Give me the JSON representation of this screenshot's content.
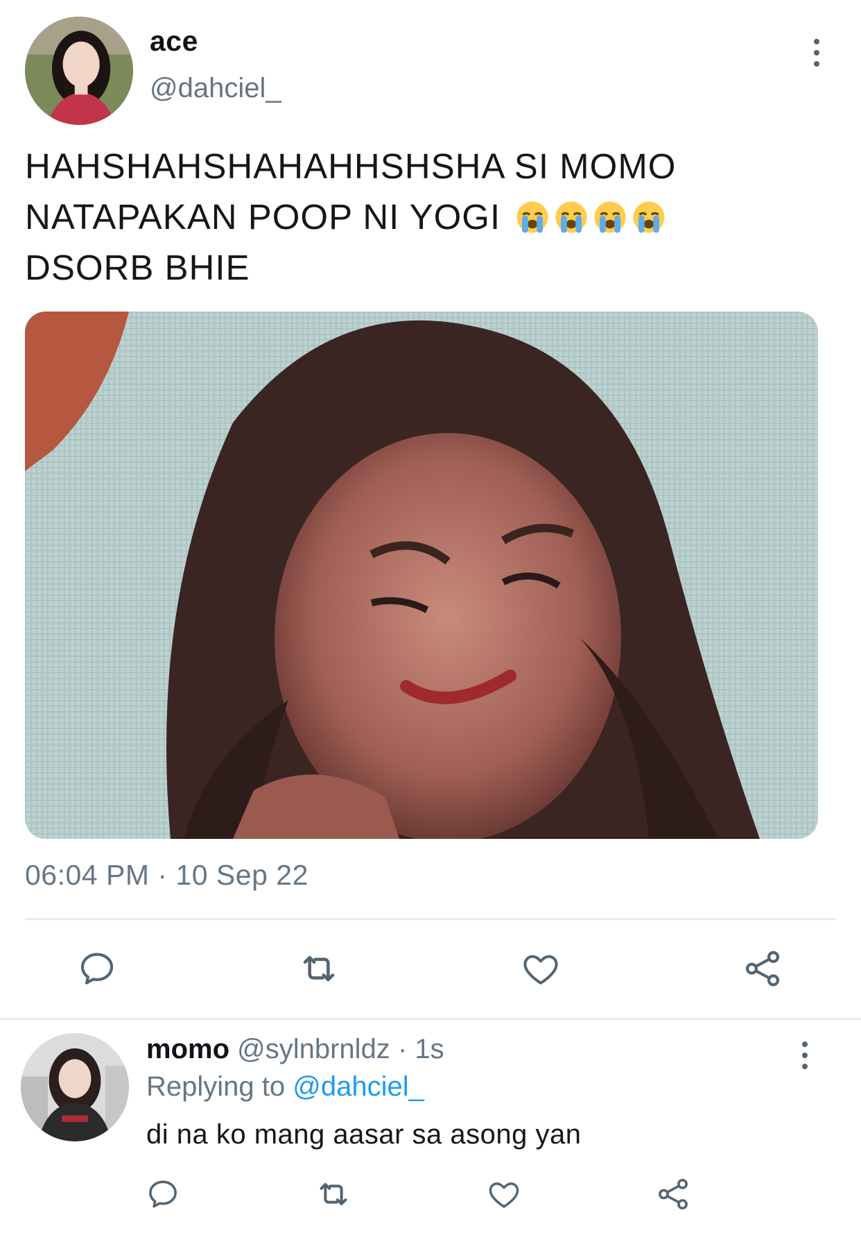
{
  "tweet": {
    "display_name": "ace",
    "handle": "@dahciel_",
    "text_line1": "HAHSHAHSHAHAHHSHSHA SI MOMO",
    "text_line2": "NATAPAKAN POOP NI YOGI",
    "text_emojis": "😭😭😭😭",
    "text_line3": "DSORB BHIE",
    "timestamp": "06:04 PM · 10 Sep 22"
  },
  "reply": {
    "display_name": "momo",
    "handle": "@sylnbrnldz",
    "time": "· 1s",
    "replying_prefix": "Replying to",
    "replying_to": "@dahciel_",
    "text": "di na ko mang aasar sa asong yan"
  },
  "icons": {
    "more": "more-vertical-icon",
    "reply": "comment-icon",
    "retweet": "retweet-icon",
    "like": "heart-icon",
    "share": "share-icon"
  },
  "colors": {
    "icon": "#536471",
    "link": "#1d9bf0",
    "secondary_text": "#657786",
    "divider": "#e6ecf0"
  }
}
